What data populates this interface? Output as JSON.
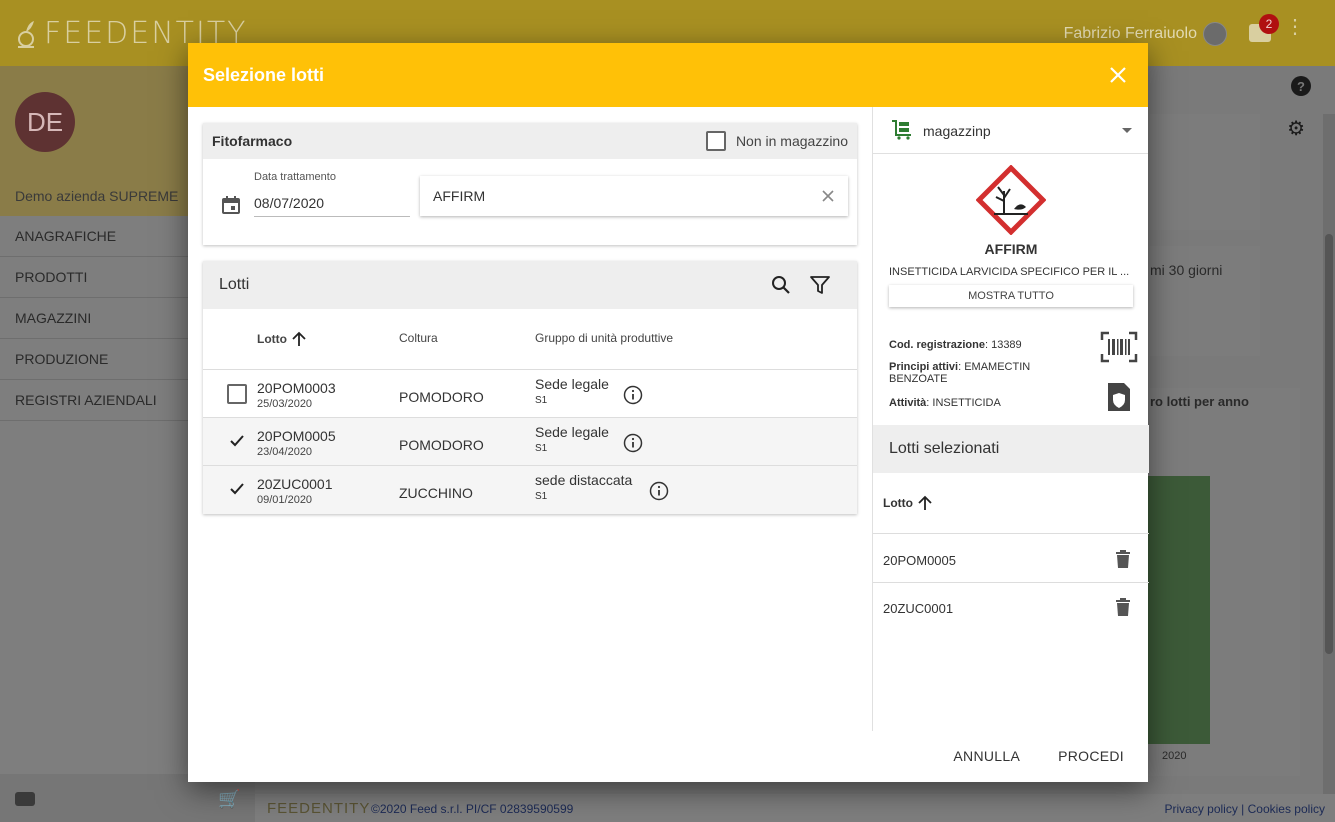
{
  "app": {
    "logo_text": "FEEDENTITY",
    "user_name": "Fabrizio Ferraiuolo",
    "notifications_count": "2",
    "avatar_initials": "DE",
    "company_name": "Demo azienda SUPREME",
    "nav": [
      "ANAGRAFICHE",
      "PRODOTTI",
      "MAGAZZINI",
      "PRODUZIONE",
      "REGISTRI AZIENDALI"
    ],
    "bg_card_text": "mi 30 giorni",
    "bg_chart_title": "ro lotti per anno",
    "bg_chart_year": "2020",
    "footer_logo": "FEEDENTITY",
    "footer_copy": "©2020 Feed s.r.l. PI/CF 02839590599",
    "footer_links": "Privacy policy | Cookies policy"
  },
  "modal": {
    "title": "Selezione lotti",
    "fitofarmaco": {
      "title": "Fitofarmaco",
      "non_in_magazzino": "Non in magazzino",
      "date_label": "Data trattamento",
      "date_value": "08/07/2020",
      "product_value": "AFFIRM"
    },
    "lotti": {
      "title": "Lotti",
      "columns": [
        "Lotto",
        "Coltura",
        "Gruppo di unità produttive"
      ],
      "rows": [
        {
          "code": "20POM0003",
          "date": "25/03/2020",
          "coltura": "POMODORO",
          "gruppo": "Sede legale",
          "sub": "S1",
          "selected": false
        },
        {
          "code": "20POM0005",
          "date": "23/04/2020",
          "coltura": "POMODORO",
          "gruppo": "Sede legale",
          "sub": "S1",
          "selected": true
        },
        {
          "code": "20ZUC0001",
          "date": "09/01/2020",
          "coltura": "ZUCCHINO",
          "gruppo": "sede distaccata",
          "sub": "S1",
          "selected": true
        }
      ]
    },
    "product": {
      "magazzino": "magazzinp",
      "name": "AFFIRM",
      "description": "INSETTICIDA LARVICIDA SPECIFICO PER IL ...",
      "show_all": "MOSTRA TUTTO",
      "reg_label": "Cod. registrazione",
      "reg_value": ": 13389",
      "principi_label": "Principi attivi",
      "principi_value": ": EMAMECTIN BENZOATE",
      "attivita_label": "Attività",
      "attivita_value": ": INSETTICIDA"
    },
    "selected": {
      "title": "Lotti selezionati",
      "column": "Lotto",
      "items": [
        "20POM0005",
        "20ZUC0001"
      ]
    },
    "actions": {
      "cancel": "ANNULLA",
      "proceed": "PROCEDI"
    }
  },
  "colors": {
    "header": "#ffc107",
    "hazard": "#d32f2f",
    "accent_green": "#2e7d32"
  }
}
